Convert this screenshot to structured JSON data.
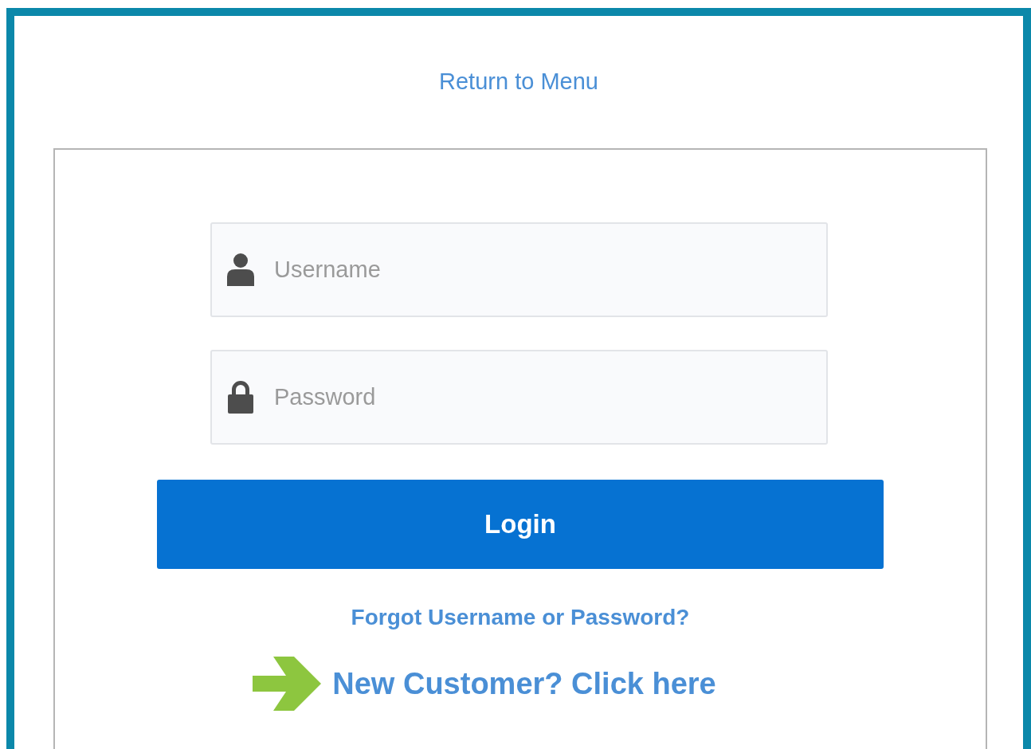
{
  "return_link": "Return to Menu",
  "fields": [
    {
      "kind": "user",
      "placeholder": "Username"
    },
    {
      "kind": "lock",
      "placeholder": "Password"
    }
  ],
  "login_button": "Login",
  "forgot_link": "Forgot Username or Password?",
  "new_customer_link": "New Customer? Click here"
}
